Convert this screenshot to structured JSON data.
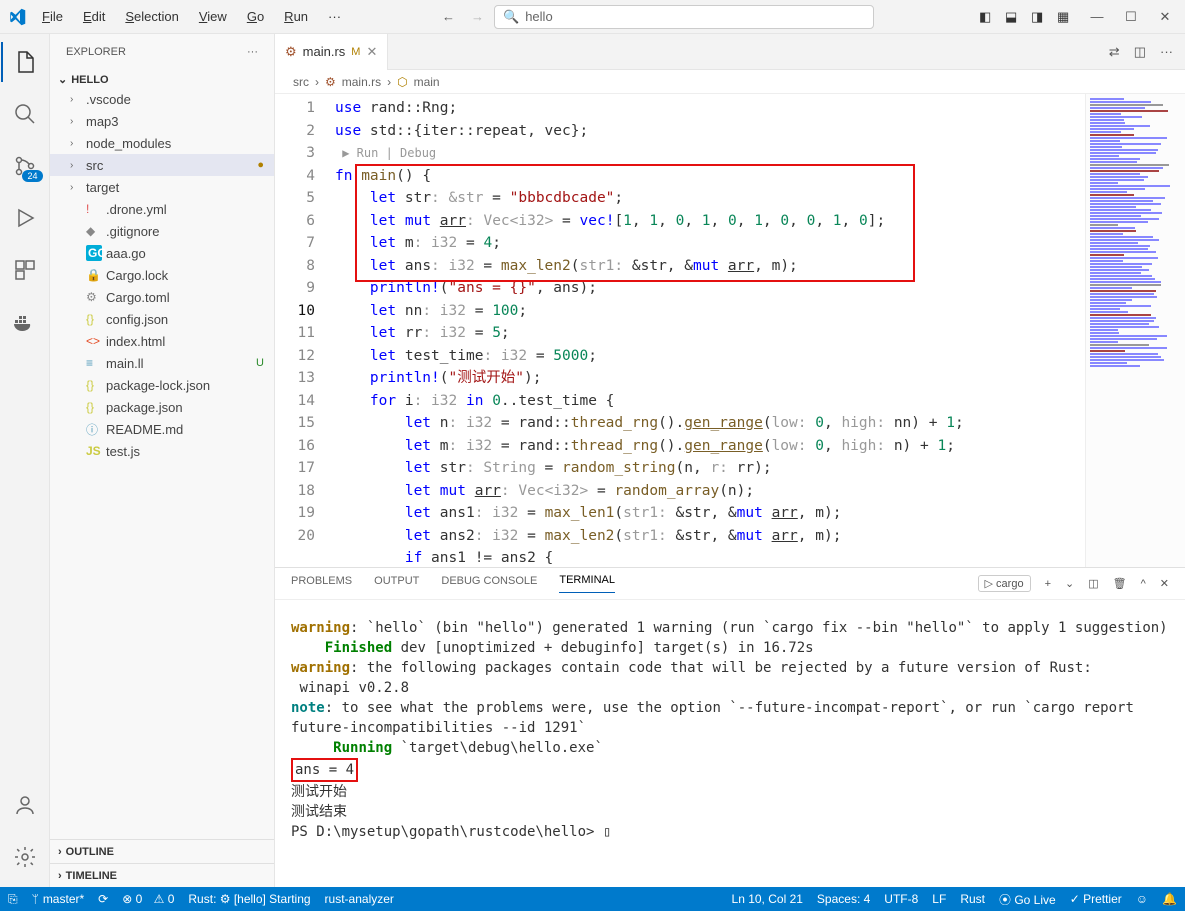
{
  "menu": [
    "File",
    "Edit",
    "Selection",
    "View",
    "Go",
    "Run",
    "···"
  ],
  "search_box": "hello",
  "explorer": {
    "title": "EXPLORER",
    "project": "HELLO",
    "folders": [
      {
        "name": ".vscode",
        "type": "folder"
      },
      {
        "name": "map3",
        "type": "folder"
      },
      {
        "name": "node_modules",
        "type": "folder"
      },
      {
        "name": "src",
        "type": "folder",
        "active": true,
        "status": "●"
      },
      {
        "name": "target",
        "type": "folder"
      }
    ],
    "files": [
      {
        "name": ".drone.yml",
        "icon": "!",
        "color": "#e05050"
      },
      {
        "name": ".gitignore",
        "icon": "◆",
        "color": "#888"
      },
      {
        "name": "aaa.go",
        "icon": "GO",
        "cls": "ficon-go"
      },
      {
        "name": "Cargo.lock",
        "icon": "🔒",
        "color": "#888"
      },
      {
        "name": "Cargo.toml",
        "icon": "⚙",
        "cls": "ficon-toml"
      },
      {
        "name": "config.json",
        "icon": "{}",
        "cls": "ficon-json"
      },
      {
        "name": "index.html",
        "icon": "<>",
        "cls": "ficon-html"
      },
      {
        "name": "main.ll",
        "icon": "≡",
        "cls": "ficon-ll",
        "status": "U",
        "statuscolor": "#2a8a2a"
      },
      {
        "name": "package-lock.json",
        "icon": "{}",
        "cls": "ficon-json"
      },
      {
        "name": "package.json",
        "icon": "{}",
        "cls": "ficon-json"
      },
      {
        "name": "README.md",
        "icon": "ⓘ",
        "cls": "ficon-md"
      },
      {
        "name": "test.js",
        "icon": "JS",
        "cls": "ficon-js"
      }
    ],
    "outline": "OUTLINE",
    "timeline": "TIMELINE"
  },
  "tab": {
    "file": "main.rs",
    "mod": "M"
  },
  "breadcrumb": [
    "src",
    "main.rs",
    "main"
  ],
  "code": {
    "lines": [
      {
        "n": 1,
        "html": "<span class='kw'>use</span> rand::Rng;"
      },
      {
        "n": 2,
        "html": "<span class='kw'>use</span> std::{iter::repeat, vec};"
      },
      {
        "n": null,
        "html": "<span class='codelens'> ▶ Run | Debug</span>"
      },
      {
        "n": 3,
        "html": "<span class='kw'>fn</span> <span class='fn'>main</span>() {"
      },
      {
        "n": 4,
        "html": "    <span class='kw'>let</span> str<span class='hint'>: &str</span> = <span class='str'>\"bbbcdbcade\"</span>;"
      },
      {
        "n": 5,
        "html": "    <span class='kw'>let</span> <span class='kw'>mut</span> <span class='und'>arr</span><span class='hint'>: Vec&lt;i32&gt;</span> = <span class='mac'>vec!</span>[<span class='num'>1</span>, <span class='num'>1</span>, <span class='num'>0</span>, <span class='num'>1</span>, <span class='num'>0</span>, <span class='num'>1</span>, <span class='num'>0</span>, <span class='num'>0</span>, <span class='num'>1</span>, <span class='num'>0</span>];"
      },
      {
        "n": 6,
        "html": "    <span class='kw'>let</span> m<span class='hint'>: i32</span> = <span class='num'>4</span>;"
      },
      {
        "n": 7,
        "html": "    <span class='kw'>let</span> ans<span class='hint'>: i32</span> = <span class='fn'>max_len2</span>(<span class='hint'>str1: </span>&str, &<span class='kw'>mut</span> <span class='und'>arr</span>, m);"
      },
      {
        "n": 8,
        "html": "    <span class='mac'>println!</span>(<span class='str'>\"ans = {}\"</span>, ans);"
      },
      {
        "n": 9,
        "html": "    <span class='kw'>let</span> nn<span class='hint'>: i32</span> = <span class='num'>100</span>;"
      },
      {
        "n": 10,
        "html": "    <span class='kw'>let</span> rr<span class='hint'>: i32</span> = <span class='num'>5</span>;",
        "current": true
      },
      {
        "n": 11,
        "html": "    <span class='kw'>let</span> test_time<span class='hint'>: i32</span> = <span class='num'>5000</span>;"
      },
      {
        "n": 12,
        "html": "    <span class='mac'>println!</span>(<span class='str'>\"测试开始\"</span>);"
      },
      {
        "n": 13,
        "html": "    <span class='kw'>for</span> i<span class='hint'>: i32</span> <span class='kw'>in</span> <span class='num'>0</span>..test_time {"
      },
      {
        "n": 14,
        "html": "        <span class='kw'>let</span> n<span class='hint'>: i32</span> = rand::<span class='fn'>thread_rng</span>().<span class='fn und'>gen_range</span>(<span class='hint'>low: </span><span class='num'>0</span>, <span class='hint'>high: </span>nn) + <span class='num'>1</span>;"
      },
      {
        "n": 15,
        "html": "        <span class='kw'>let</span> m<span class='hint'>: i32</span> = rand::<span class='fn'>thread_rng</span>().<span class='fn und'>gen_range</span>(<span class='hint'>low: </span><span class='num'>0</span>, <span class='hint'>high: </span>n) + <span class='num'>1</span>;"
      },
      {
        "n": 16,
        "html": "        <span class='kw'>let</span> str<span class='hint'>: String</span> = <span class='fn'>random_string</span>(n, <span class='hint'>r: </span>rr);"
      },
      {
        "n": 17,
        "html": "        <span class='kw'>let</span> <span class='kw'>mut</span> <span class='und'>arr</span><span class='hint'>: Vec&lt;i32&gt;</span> = <span class='fn'>random_array</span>(n);"
      },
      {
        "n": 18,
        "html": "        <span class='kw'>let</span> ans1<span class='hint'>: i32</span> = <span class='fn'>max_len1</span>(<span class='hint'>str1: </span>&str, &<span class='kw'>mut</span> <span class='und'>arr</span>, m);"
      },
      {
        "n": 19,
        "html": "        <span class='kw'>let</span> ans2<span class='hint'>: i32</span> = <span class='fn'>max_len2</span>(<span class='hint'>str1: </span>&str, &<span class='kw'>mut</span> <span class='und'>arr</span>, m);"
      },
      {
        "n": 20,
        "html": "        <span class='kw'>if</span> ans1 != ans2 {"
      }
    ]
  },
  "panel": {
    "tabs": [
      "PROBLEMS",
      "OUTPUT",
      "DEBUG CONSOLE",
      "TERMINAL"
    ],
    "active": "TERMINAL",
    "task": "cargo",
    "output_html": "<span class='warn'>warning</span>: `hello` (bin \"hello\") generated 1 warning (run `cargo fix --bin \"hello\"` to apply 1 suggestion)\n    <span class='green'>Finished</span> dev [unoptimized + debuginfo] target(s) in 16.72s\n<span class='warn'>warning</span>: the following packages contain code that will be rejected by a future version of Rust:\n winapi v0.2.8\n<span class='note'>note</span>: to see what the problems were, use the option `--future-incompat-report`, or run `cargo report future-incompatibilities --id 1291`\n     <span class='green'>Running</span> `target\\debug\\hello.exe`\n<span class='redbox2'>ans = 4</span>\n测试开始\n测试结束\nPS D:\\mysetup\\gopath\\rustcode\\hello> ▯"
  },
  "status": {
    "branch": "master*",
    "sync": "⟳",
    "errors": "⊗ 0",
    "warns": "⚠ 0",
    "rust": "Rust: ⚙ [hello] Starting",
    "analyzer": "rust-analyzer",
    "pos": "Ln 10, Col 21",
    "spaces": "Spaces: 4",
    "enc": "UTF-8",
    "eol": "LF",
    "lang": "Rust",
    "golive": "⦿ Go Live",
    "prettier": "✓ Prettier"
  },
  "scm_badge": "24"
}
